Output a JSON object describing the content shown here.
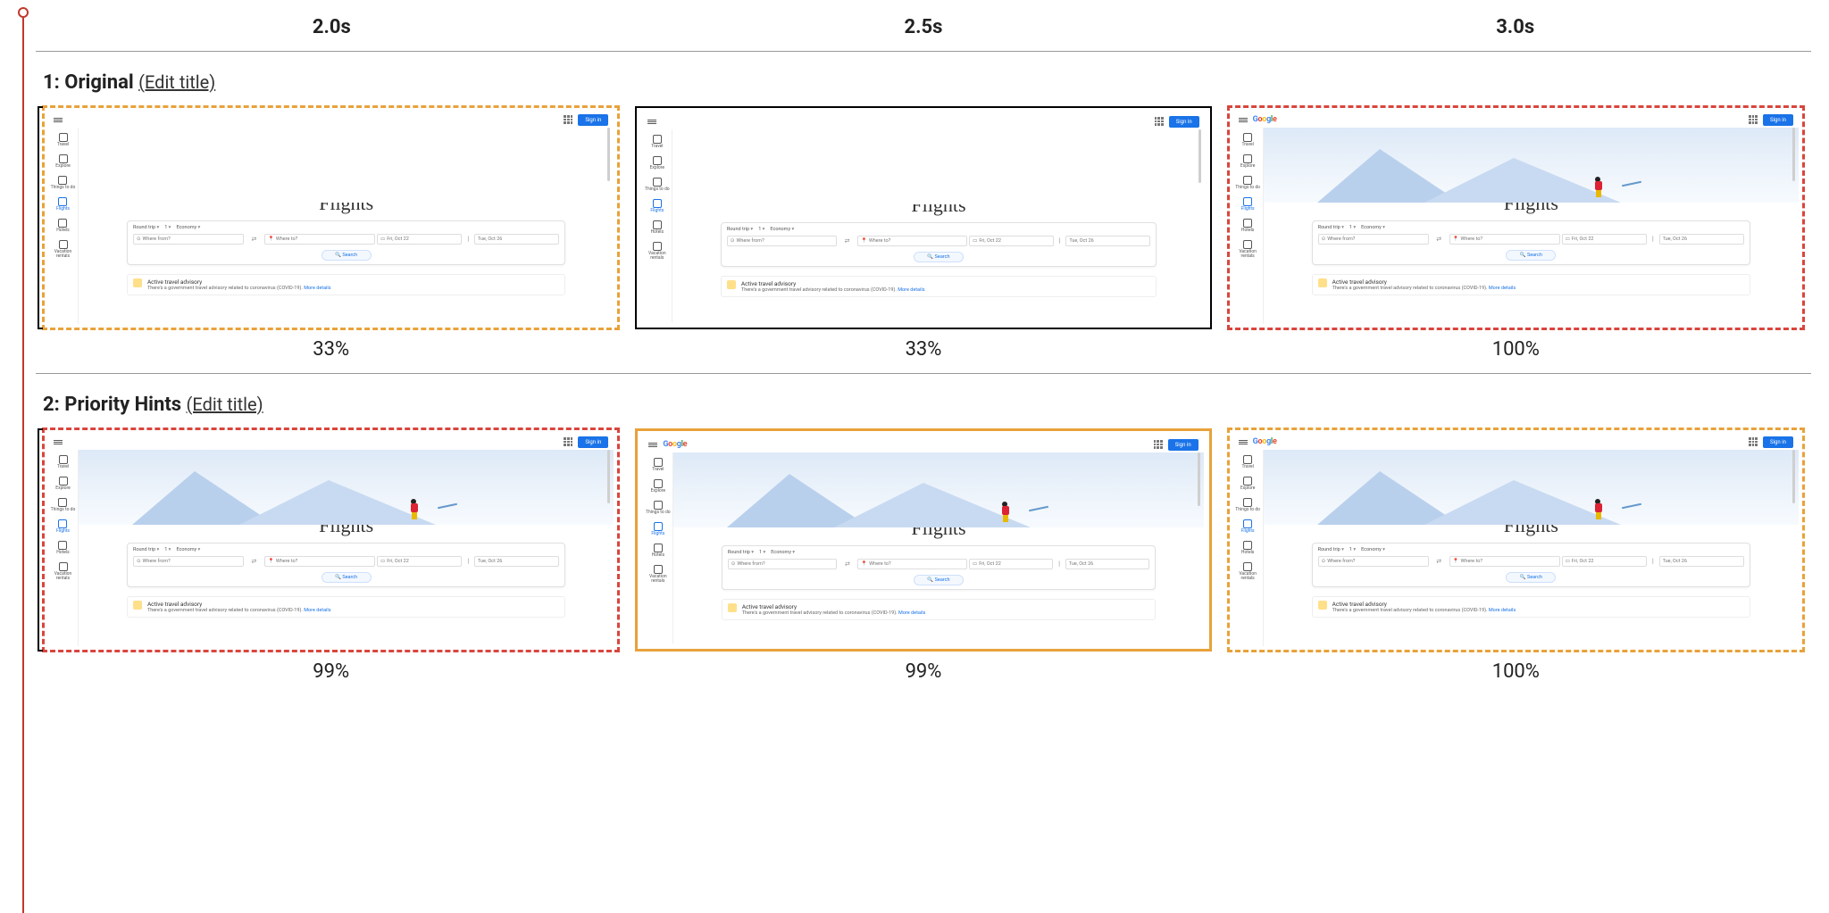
{
  "time_headers": [
    "2.0s",
    "2.5s",
    "3.0s"
  ],
  "rows": [
    {
      "index": "1",
      "title": "Original",
      "edit_label": "(Edit title)",
      "cells": [
        {
          "percent": "33%",
          "border": "dashed-orange",
          "hero": "blank",
          "logo": false
        },
        {
          "percent": "33%",
          "border": "solid-black",
          "hero": "blank",
          "logo": false
        },
        {
          "percent": "100%",
          "border": "dashed-red",
          "hero": "image",
          "logo": true
        }
      ]
    },
    {
      "index": "2",
      "title": "Priority Hints",
      "edit_label": "(Edit title)",
      "cells": [
        {
          "percent": "99%",
          "border": "dashed-red",
          "hero": "image",
          "logo": false
        },
        {
          "percent": "99%",
          "border": "solid-orange",
          "hero": "image",
          "logo": true
        },
        {
          "percent": "100%",
          "border": "dashed-orange",
          "hero": "image",
          "logo": true
        }
      ]
    }
  ],
  "mini": {
    "signin": "Sign in",
    "logo": "Google",
    "page_title": "Flights",
    "sidebar": [
      {
        "label": "Travel"
      },
      {
        "label": "Explore"
      },
      {
        "label": "Things to do"
      },
      {
        "label": "Flights",
        "active": true
      },
      {
        "label": "Hotels"
      },
      {
        "label": "Vacation rentals"
      }
    ],
    "trip_type": "Round trip",
    "passengers": "1",
    "cabin": "Economy",
    "where_from": "Where from?",
    "where_to": "Where to?",
    "date_out": "Fri, Oct 22",
    "date_back": "Tue, Oct 26",
    "search_btn": "Search",
    "advisory_title": "Active travel advisory",
    "advisory_sub": "There's a government travel advisory related to coronavirus (COVID-19).",
    "advisory_link": "More details"
  }
}
